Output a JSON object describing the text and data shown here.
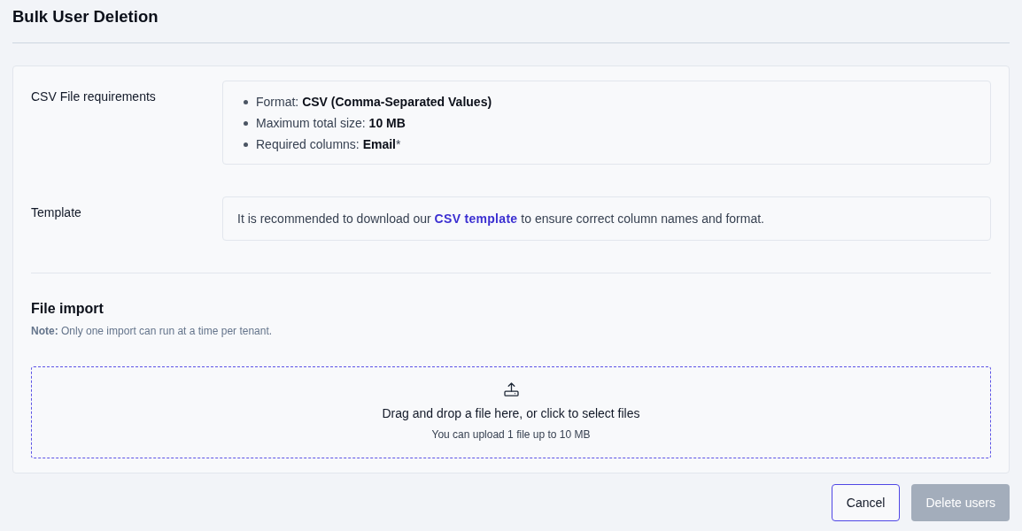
{
  "page": {
    "title": "Bulk User Deletion"
  },
  "requirements": {
    "label": "CSV File requirements",
    "items": [
      "Format: **CSV (Comma-Separated Values)**",
      "Maximum total size: **10 MB**",
      "Required columns: **Email***"
    ]
  },
  "template": {
    "label": "Template",
    "text_before": "It is recommended to download our ",
    "link": "CSV template",
    "text_after": " to ensure correct column names and format."
  },
  "file_import": {
    "heading": "File import",
    "note": "**Note:** Only one import can run at a time per tenant.",
    "dropzone": {
      "text": "Drag and drop a file here, or click to select files",
      "hint": "You can upload 1 file up to 10 MB"
    }
  },
  "buttons": [
    {
      "label": "Cancel",
      "kind": "secondary",
      "disabled": false
    },
    {
      "label": "Delete users",
      "kind": "primary",
      "disabled": true
    }
  ]
}
